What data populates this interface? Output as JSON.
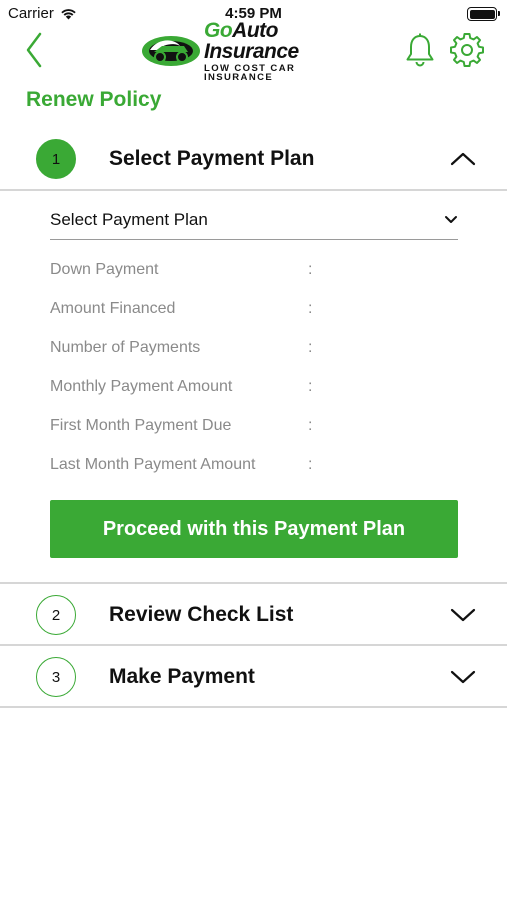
{
  "status_bar": {
    "carrier": "Carrier",
    "time": "4:59 PM"
  },
  "header": {
    "logo_go": "Go",
    "logo_title": "Auto Insurance",
    "logo_tagline": "LOW COST CAR INSURANCE"
  },
  "page": {
    "title": "Renew Policy"
  },
  "steps": [
    {
      "number": "1",
      "title": "Select Payment Plan",
      "state": "expanded",
      "select_label": "Select Payment Plan",
      "details": [
        {
          "label": "Down Payment",
          "sep": ":",
          "value": ""
        },
        {
          "label": "Amount Financed",
          "sep": ":",
          "value": ""
        },
        {
          "label": "Number of Payments",
          "sep": ":",
          "value": ""
        },
        {
          "label": "Monthly Payment Amount",
          "sep": ":",
          "value": ""
        },
        {
          "label": "First Month Payment Due",
          "sep": ":",
          "value": ""
        },
        {
          "label": "Last Month Payment Amount",
          "sep": ":",
          "value": ""
        }
      ],
      "button_label": "Proceed with this Payment Plan"
    },
    {
      "number": "2",
      "title": "Review Check List",
      "state": "collapsed"
    },
    {
      "number": "3",
      "title": "Make Payment",
      "state": "collapsed"
    }
  ],
  "colors": {
    "brand_green": "#3aa935",
    "muted_text": "#8a8a8a",
    "divider": "#d6d6d6"
  },
  "icons": [
    "wifi-icon",
    "battery-icon",
    "back-chevron-icon",
    "logo-icon",
    "bell-icon",
    "gear-icon",
    "chevron-up-icon",
    "chevron-down-icon"
  ]
}
